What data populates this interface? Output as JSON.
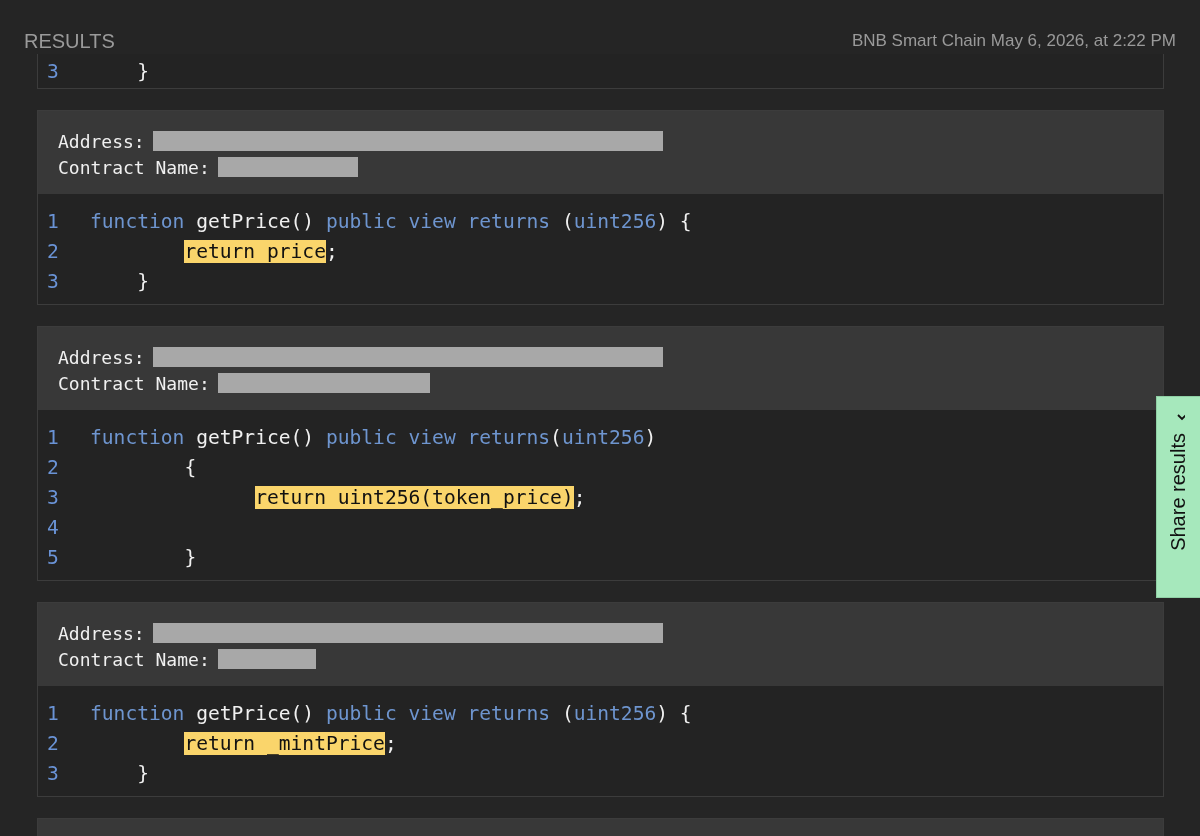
{
  "header": {
    "title": "RESULTS",
    "meta": "BNB Smart Chain May 6, 2026, at 2:22 PM"
  },
  "cards": [
    {
      "lines": [
        {
          "number": "3",
          "tokens": [
            {
              "text": "    }",
              "kind": "plain"
            }
          ]
        }
      ]
    },
    {
      "address_label": "Address:",
      "name_label": "Contract Name:",
      "lines": [
        {
          "number": "1",
          "tokens": [
            {
              "text": "function",
              "kind": "keyword"
            },
            {
              "text": " getPrice() ",
              "kind": "plain"
            },
            {
              "text": "public view returns",
              "kind": "keyword"
            },
            {
              "text": " (",
              "kind": "plain"
            },
            {
              "text": "uint256",
              "kind": "keyword"
            },
            {
              "text": ") {",
              "kind": "plain"
            }
          ]
        },
        {
          "number": "2",
          "tokens": [
            {
              "text": "        return price",
              "kind": "highlight"
            },
            {
              "text": ";",
              "kind": "plain"
            }
          ]
        },
        {
          "number": "3",
          "tokens": [
            {
              "text": "    }",
              "kind": "plain"
            }
          ]
        }
      ]
    },
    {
      "address_label": "Address:",
      "name_label": "Contract Name:",
      "lines": [
        {
          "number": "1",
          "tokens": [
            {
              "text": "function",
              "kind": "keyword"
            },
            {
              "text": " getPrice() ",
              "kind": "plain"
            },
            {
              "text": "public view returns",
              "kind": "keyword"
            },
            {
              "text": "(",
              "kind": "plain"
            },
            {
              "text": "uint256",
              "kind": "keyword"
            },
            {
              "text": ")",
              "kind": "plain"
            }
          ]
        },
        {
          "number": "2",
          "tokens": [
            {
              "text": "        {",
              "kind": "plain"
            }
          ]
        },
        {
          "number": "3",
          "tokens": [
            {
              "text": "              return uint256(token_price)",
              "kind": "highlight"
            },
            {
              "text": ";",
              "kind": "plain"
            }
          ]
        },
        {
          "number": "4"
        },
        {
          "number": "5",
          "tokens": [
            {
              "text": "        }",
              "kind": "plain"
            }
          ]
        }
      ]
    },
    {
      "address_label": "Address:",
      "name_label": "Contract Name:",
      "lines": [
        {
          "number": "1",
          "tokens": [
            {
              "text": "function",
              "kind": "keyword"
            },
            {
              "text": " getPrice() ",
              "kind": "plain"
            },
            {
              "text": "public view returns",
              "kind": "keyword"
            },
            {
              "text": " (",
              "kind": "plain"
            },
            {
              "text": "uint256",
              "kind": "keyword"
            },
            {
              "text": ") {",
              "kind": "plain"
            }
          ]
        },
        {
          "number": "2",
          "tokens": [
            {
              "text": "        return _mintPrice",
              "kind": "highlight"
            },
            {
              "text": ";",
              "kind": "plain"
            }
          ]
        },
        {
          "number": "3",
          "tokens": [
            {
              "text": "    }",
              "kind": "plain"
            }
          ]
        }
      ]
    }
  ],
  "share_button": {
    "label": "Share results"
  }
}
